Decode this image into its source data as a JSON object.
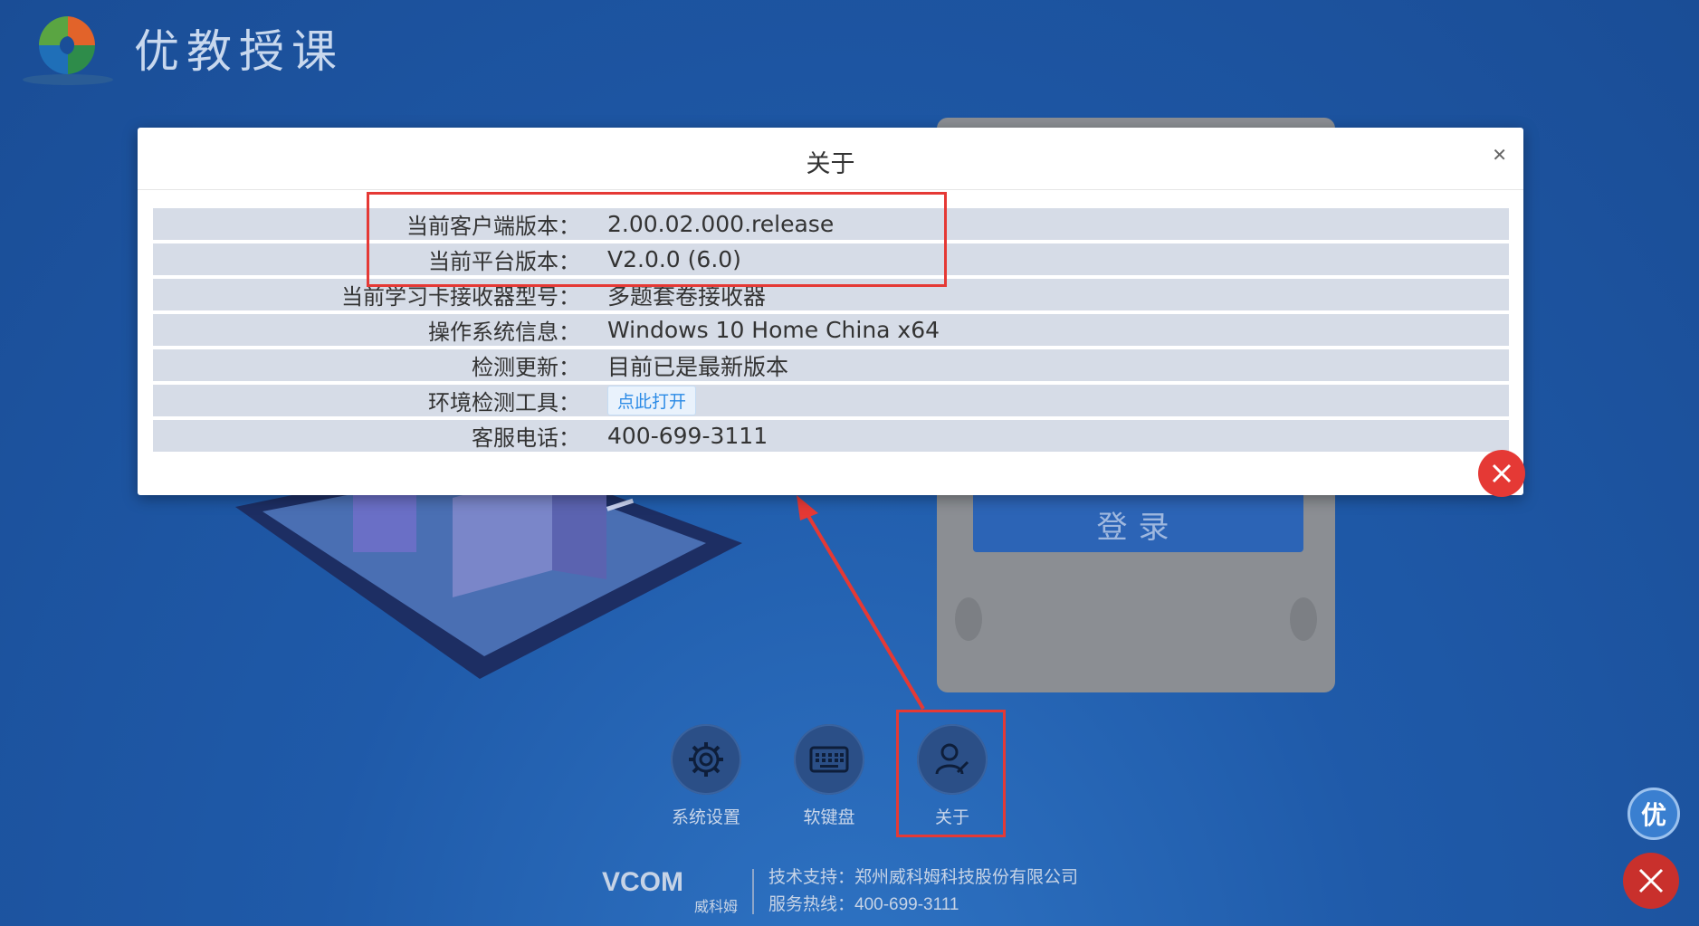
{
  "app": {
    "brand_title": "优教授课"
  },
  "background": {
    "login_button_label": "登录",
    "tools": [
      {
        "label": "系统设置",
        "icon": "gear-icon"
      },
      {
        "label": "软键盘",
        "icon": "keyboard-icon"
      },
      {
        "label": "关于",
        "icon": "user-edit-icon"
      }
    ],
    "footer": {
      "logo_text": "VCOM",
      "logo_sub": "威科姆",
      "support": "技术支持：郑州威科姆科技股份有限公司",
      "hotline": "服务热线：400-699-3111"
    },
    "side_badge": "优"
  },
  "modal": {
    "title": "关于",
    "rows": [
      {
        "label": "当前客户端版本：",
        "value": "2.00.02.000.release"
      },
      {
        "label": "当前平台版本：",
        "value": "V2.0.0 (6.0)"
      },
      {
        "label": "当前学习卡接收器型号：",
        "value": "多题套卷接收器"
      },
      {
        "label": "操作系统信息：",
        "value": "Windows 10 Home China x64"
      },
      {
        "label": "检测更新：",
        "value": "目前已是最新版本"
      },
      {
        "label": "环境检测工具：",
        "button": "点此打开"
      },
      {
        "label": "客服电话：",
        "value": "400-699-3111"
      }
    ]
  },
  "colors": {
    "accent_red": "#e53935",
    "link_blue": "#2b8be6",
    "background_blue": "#1f5aa9"
  }
}
